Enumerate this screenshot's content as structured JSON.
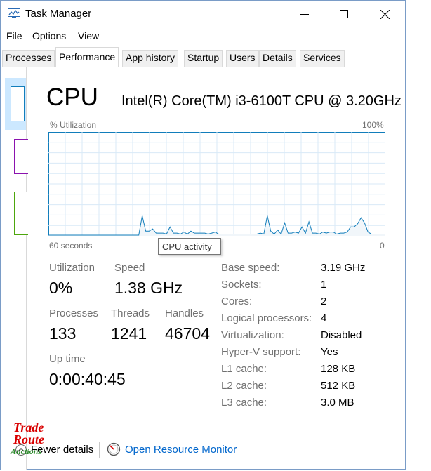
{
  "window": {
    "title": "Task Manager",
    "controls": [
      "minimize",
      "maximize",
      "close"
    ]
  },
  "menu": [
    "File",
    "Options",
    "View"
  ],
  "tabs": [
    "Processes",
    "Performance",
    "App history",
    "Startup",
    "Users",
    "Details",
    "Services"
  ],
  "active_tab": "Performance",
  "cpu": {
    "title": "CPU",
    "model": "Intel(R) Core(TM) i3-6100T CPU @ 3.20GHz",
    "y_axis_label": "% Utilization",
    "y_max_label": "100%",
    "x_left_label": "60 seconds",
    "x_right_label": "0",
    "tooltip": "CPU activity",
    "graph_samples": [
      0,
      0,
      0,
      0,
      0,
      0,
      0,
      0,
      0,
      0,
      0,
      0,
      0,
      0,
      0,
      0,
      0,
      0,
      0,
      0,
      0,
      0,
      0,
      0,
      0,
      0,
      0,
      0,
      0,
      0,
      0,
      0,
      0,
      0,
      0,
      0,
      0,
      0,
      0,
      0,
      0,
      0,
      0,
      0,
      0,
      0,
      0,
      0,
      0,
      0,
      0,
      0,
      0,
      0,
      0,
      0,
      0,
      0,
      0,
      0,
      0,
      0,
      0,
      0,
      0,
      0,
      0,
      0,
      0,
      0,
      0,
      0,
      0,
      0,
      0,
      0,
      0,
      0,
      0,
      0,
      0,
      0,
      0,
      0,
      0,
      0,
      0,
      0,
      0,
      0,
      0,
      0,
      0,
      0,
      0,
      0,
      0,
      0,
      0,
      0,
      0,
      0,
      0,
      0,
      0,
      0,
      0,
      0,
      0,
      0,
      0,
      0,
      0,
      0,
      0,
      0,
      0,
      0,
      0,
      0,
      0,
      0,
      0,
      0,
      0,
      0,
      0,
      0,
      0,
      0,
      0,
      0,
      0,
      0,
      0,
      0,
      0,
      0,
      0,
      0,
      0,
      0,
      0,
      0,
      0,
      0,
      0,
      0,
      0,
      0,
      0,
      0,
      0,
      0,
      0,
      0,
      0,
      0,
      0,
      0,
      0,
      0,
      0,
      0,
      0,
      0,
      0,
      0,
      0,
      0,
      0,
      0,
      0,
      0,
      0,
      0,
      0,
      0,
      0,
      0,
      0,
      0,
      0,
      0,
      0,
      0,
      0,
      0,
      0,
      0,
      0,
      0,
      0,
      0,
      0,
      0,
      0,
      0,
      0,
      0,
      0,
      0,
      0,
      0,
      0,
      0,
      0,
      0,
      0,
      0,
      0,
      0,
      0,
      0,
      0,
      0,
      0,
      0,
      0,
      0,
      0,
      0,
      0,
      0,
      0,
      0,
      0,
      0,
      0,
      0,
      0,
      0,
      0,
      0,
      0,
      0,
      0,
      0,
      0,
      0,
      0,
      0,
      0,
      0,
      0,
      0,
      0,
      0,
      0,
      0,
      0,
      0,
      0,
      0,
      0,
      0,
      0,
      0,
      0,
      0,
      0,
      0,
      0,
      0,
      0,
      0,
      0,
      0,
      0,
      0,
      0,
      0,
      0,
      0,
      0,
      0,
      0,
      0,
      0,
      0,
      0,
      0,
      0,
      0,
      0,
      0,
      0,
      0,
      0,
      0,
      0,
      0,
      0,
      0,
      0,
      0,
      0,
      0,
      0,
      0,
      0,
      0,
      0,
      0,
      0,
      0,
      0,
      0,
      0,
      0,
      0,
      0,
      0,
      0,
      0,
      0,
      0,
      0,
      0,
      0,
      0,
      0,
      0,
      0,
      0,
      0,
      0,
      0,
      0,
      0,
      0,
      0,
      0,
      0,
      0,
      0,
      0,
      0,
      0,
      0,
      0,
      0,
      0,
      0,
      0,
      0,
      0,
      0,
      0,
      0,
      0,
      0,
      0,
      0,
      0,
      0,
      0,
      0,
      0,
      0,
      0,
      0,
      0,
      0,
      0,
      0,
      0,
      0,
      0,
      0,
      0,
      0,
      0,
      0,
      0,
      0,
      0,
      0,
      0,
      0,
      0,
      0,
      0,
      0,
      0,
      0,
      0,
      0,
      0,
      0,
      0,
      0,
      0,
      0,
      0,
      0,
      0,
      0,
      0,
      0,
      0,
      0,
      0,
      0,
      0,
      0,
      0,
      0,
      0,
      0,
      0,
      0,
      0,
      0,
      0,
      0,
      0,
      0,
      0,
      0,
      0,
      0,
      0,
      0,
      0,
      0,
      0,
      0,
      0,
      0,
      0,
      0,
      0,
      0,
      0,
      0,
      0,
      0,
      0,
      0,
      0,
      0,
      0,
      0,
      0,
      0,
      0,
      0,
      0,
      0,
      0,
      0,
      0,
      0,
      0,
      0,
      0,
      0,
      0,
      0,
      0,
      0,
      0,
      0,
      0,
      0,
      0,
      0,
      0,
      0,
      0,
      0,
      0,
      0,
      0,
      0,
      0,
      0,
      0,
      0,
      0,
      0,
      0,
      0,
      0,
      0,
      0,
      0,
      0,
      0,
      0,
      0,
      0,
      0,
      0,
      0,
      0,
      0,
      0,
      0,
      0,
      0,
      0,
      0,
      0,
      0,
      0,
      0,
      0,
      0,
      0
    ],
    "utilization_series": [
      0,
      0,
      0,
      0,
      0,
      0,
      0,
      0,
      0,
      0,
      0,
      0,
      0,
      0,
      0,
      0,
      0,
      0,
      0,
      0,
      0,
      0,
      0,
      0,
      0,
      0,
      0,
      19,
      4,
      4,
      6,
      2,
      2,
      2,
      1,
      8,
      2,
      2,
      1,
      3,
      1,
      4,
      2,
      2,
      2,
      2,
      1,
      2,
      3,
      1,
      1,
      1,
      1,
      1,
      1,
      1,
      1,
      1,
      1,
      1,
      1,
      2,
      1,
      19,
      4,
      1,
      5,
      1,
      12,
      2,
      2,
      3,
      2,
      8,
      2,
      13,
      2,
      2,
      1,
      3,
      2,
      3,
      3,
      1,
      2,
      2,
      3,
      8,
      8,
      11,
      17,
      12,
      3,
      1,
      1,
      1,
      1,
      1
    ],
    "stats": {
      "utilization_label": "Utilization",
      "utilization_value": "0%",
      "speed_label": "Speed",
      "speed_value": "1.38 GHz",
      "processes_label": "Processes",
      "processes_value": "133",
      "threads_label": "Threads",
      "threads_value": "1241",
      "handles_label": "Handles",
      "handles_value": "46704",
      "uptime_label": "Up time",
      "uptime_value": "0:00:40:45"
    },
    "details": [
      {
        "label": "Base speed:",
        "value": "3.19 GHz"
      },
      {
        "label": "Sockets:",
        "value": "1"
      },
      {
        "label": "Cores:",
        "value": "2"
      },
      {
        "label": "Logical processors:",
        "value": "4"
      },
      {
        "label": "Virtualization:",
        "value": "Disabled"
      },
      {
        "label": "Hyper-V support:",
        "value": "Yes"
      },
      {
        "label": "L1 cache:",
        "value": "128 KB"
      },
      {
        "label": "L2 cache:",
        "value": "512 KB"
      },
      {
        "label": "L3 cache:",
        "value": "3.0 MB"
      }
    ]
  },
  "footer": {
    "fewer_details": "Fewer details",
    "open_monitor": "Open Resource Monitor"
  },
  "watermark": {
    "line1": "Trade",
    "line2": "Route",
    "line3": "Auctions"
  },
  "colors": {
    "cpu_accent": "#117dbb",
    "graph_fill": "#f1f6fa",
    "sidebar_active": "#cce8ff",
    "memory_accent": "#8b12ae",
    "disk_accent": "#4da60c",
    "link": "#0066cc"
  }
}
